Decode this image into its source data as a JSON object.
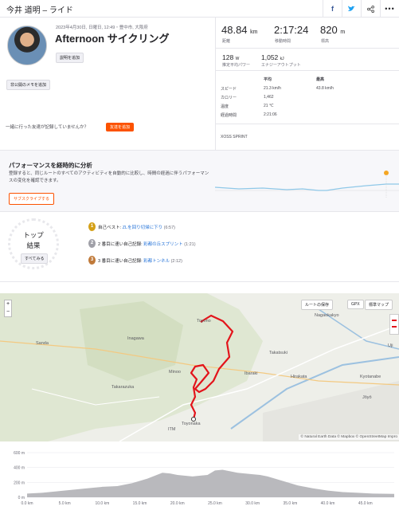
{
  "header": {
    "title": "今井 道明 – ライド",
    "icons": [
      "facebook-icon",
      "twitter-icon",
      "share-icon",
      "more-icon"
    ]
  },
  "activity": {
    "date": "2023年4月30日, 日曜日, 12:49・豊中市, 大阪府",
    "title": "Afternoon サイクリング",
    "add_desc": "説明を追加",
    "private_note": "非公開のメモを追加",
    "friend_question": "一緒に行った友達が記録していませんか？",
    "add_friend": "友達を追加"
  },
  "stats": {
    "distance": "48.84",
    "distance_unit": "km",
    "distance_label": "距離",
    "moving_time": "2:17:24",
    "moving_time_label": "移動時間",
    "elevation": "820",
    "elevation_unit": "m",
    "elevation_label": "標高",
    "power": "128",
    "power_unit": "W",
    "power_label": "推定平均パワー",
    "energy": "1,052",
    "energy_unit": "kJ",
    "energy_label": "エナジーアウトプット",
    "table_headers": [
      "平均",
      "最高"
    ],
    "rows": [
      {
        "label": "スピード",
        "avg": "21.3 km/h",
        "max": "43.8 km/h"
      },
      {
        "label": "カロリー",
        "avg": "1,462",
        "max": ""
      },
      {
        "label": "温度",
        "avg": "21 ℃",
        "max": ""
      },
      {
        "label": "経過時間",
        "avg": "2:21:06",
        "max": ""
      }
    ],
    "device": "XOSS SPRINT"
  },
  "performance": {
    "title": "パフォーマンスを経時的に分析",
    "desc": "登録すると、同じルートのすべてのアクティビティを自動的に比較し、時間の経過に伴うパフォーマンスの変化を確認できます。",
    "subscribe": "サブスクライブする"
  },
  "top": {
    "title1": "トップ",
    "title2": "結果",
    "see_all": "すべてみる",
    "items": [
      {
        "prefix": "自己ベスト: ",
        "link": "ZLを回り切帰に下り",
        "time": "(6:57)",
        "color": "#d4a017",
        "n": "1"
      },
      {
        "prefix": "2 番目に速い自己記録: ",
        "link": "彩都の丘スプリント",
        "time": "(1:21)",
        "color": "#a0a0a8",
        "n": "2"
      },
      {
        "prefix": "3 番目に速い自己記録: ",
        "link": "彩都トンネル",
        "time": "(2:12)",
        "color": "#c07a3a",
        "n": "3"
      }
    ]
  },
  "map": {
    "route_btn": "ルートの保存",
    "gpx": "GPX",
    "style_btn": "標準マップ",
    "labels": [
      "Toyono",
      "Nagaokakyo",
      "Inagawa",
      "Sanda",
      "Takatsuki",
      "Ibaraki",
      "Hirakata",
      "Takarazuka",
      "Toyonaka",
      "Kyotanabe",
      "Jōyō",
      "Uji",
      "Minoo",
      "ITM"
    ],
    "attribution": "© Natural Earth Data © Mapbox © OpenStreetMap Impro"
  },
  "elevation_chart": {
    "y_ticks": [
      "600 m",
      "400 m",
      "200 m",
      "0 m"
    ],
    "x_ticks": [
      "0.0 km",
      "5.0 km",
      "10.0 km",
      "15.0 km",
      "20.0 km",
      "25.0 km",
      "30.0 km",
      "35.0 km",
      "40.0 km",
      "45.0 km"
    ]
  },
  "chart_data": {
    "type": "area",
    "x": [
      0,
      2,
      4,
      6,
      8,
      10,
      12,
      14,
      16,
      18,
      19,
      20,
      22,
      24,
      25,
      26,
      28,
      30,
      31,
      32,
      34,
      36,
      38,
      40,
      42,
      44,
      46,
      48.84
    ],
    "y": [
      50,
      60,
      80,
      100,
      120,
      140,
      150,
      190,
      250,
      330,
      320,
      300,
      280,
      300,
      360,
      370,
      330,
      310,
      300,
      280,
      220,
      160,
      120,
      90,
      70,
      60,
      50,
      45
    ],
    "xlim": [
      0,
      48.84
    ],
    "ylim": [
      0,
      600
    ]
  }
}
